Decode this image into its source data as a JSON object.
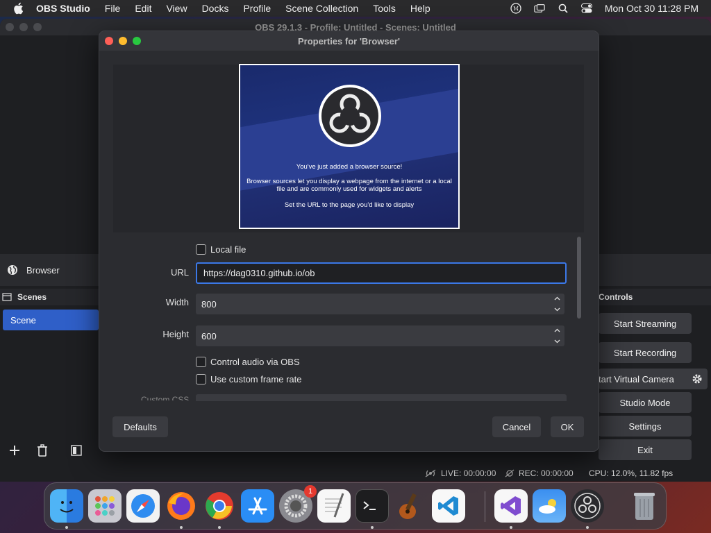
{
  "menubar": {
    "app_name": "OBS Studio",
    "items": [
      "File",
      "Edit",
      "View",
      "Docks",
      "Profile",
      "Scene Collection",
      "Tools",
      "Help"
    ],
    "clock": "Mon Oct 30  11:28 PM"
  },
  "obs_window": {
    "title": "OBS 29.1.3 - Profile: Untitled - Scenes: Untitled",
    "source_item": "Browser",
    "scenes_header": "Scenes",
    "scene_item": "Scene",
    "controls_header": "Controls",
    "controls": {
      "start_streaming": "Start Streaming",
      "start_recording": "Start Recording",
      "start_virtual_camera": "tart Virtual Camera",
      "studio_mode": "Studio Mode",
      "settings": "Settings",
      "exit": "Exit"
    },
    "status": {
      "live": "LIVE: 00:00:00",
      "rec": "REC: 00:00:00",
      "cpu": "CPU: 12.0%, 11.82 fps"
    }
  },
  "dialog": {
    "title": "Properties for 'Browser'",
    "preview": {
      "line1": "You've just added a browser source!",
      "line2": "Browser sources let you display a webpage from the internet or a local file and are commonly used for widgets and alerts",
      "line3": "Set the URL to the page you'd like to display"
    },
    "local_file_label": "Local file",
    "url_label": "URL",
    "url_value": "https://dag0310.github.io/ob",
    "width_label": "Width",
    "width_value": "800",
    "height_label": "Height",
    "height_value": "600",
    "control_audio_label": "Control audio via OBS",
    "custom_frame_rate_label": "Use custom frame rate",
    "custom_css_label": "Custom CSS",
    "defaults_button": "Defaults",
    "cancel_button": "Cancel",
    "ok_button": "OK"
  },
  "dock": {
    "apps": [
      "finder",
      "launchpad",
      "safari",
      "firefox",
      "chrome",
      "app-store",
      "system-settings",
      "textedit",
      "terminal",
      "instruments",
      "vscode",
      "visual-studio",
      "weather",
      "obs",
      "trash"
    ],
    "system_settings_badge": "1"
  },
  "colors": {
    "accent": "#3b78e7",
    "scene_selected": "#2f5fc8",
    "badge": "#e5392f"
  }
}
